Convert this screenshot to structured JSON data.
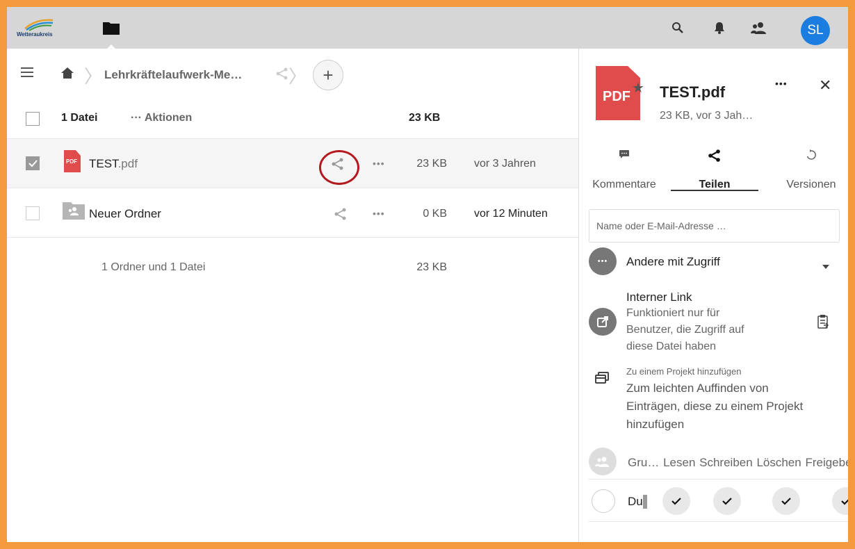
{
  "header": {
    "logo_text": "Wetteraukreis",
    "user_initials": "SL"
  },
  "breadcrumb": {
    "folder": "Lehrkräftelaufwerk-Me…"
  },
  "list_header": {
    "count": "1 Datei",
    "actions": "··· Aktionen",
    "size": "23 KB"
  },
  "files": [
    {
      "name": "TEST",
      "ext": ".pdf",
      "size": "23 KB",
      "date": "vor 3 Jahren",
      "badge": "PDF",
      "selected": true
    },
    {
      "name": "Neuer Ordner",
      "ext": "",
      "size": "0 KB",
      "date": "vor 12 Minuten",
      "selected": false
    }
  ],
  "summary": {
    "text": "1 Ordner und 1 Datei",
    "size": "23 KB"
  },
  "sidebar": {
    "file_title": "TEST.pdf",
    "file_meta": "23 KB, vor 3 Jah…",
    "pdf_badge": "PDF",
    "tabs": [
      {
        "label": "Kommentare"
      },
      {
        "label": "Teilen"
      },
      {
        "label": "Versionen"
      }
    ],
    "share_placeholder": "Name oder E-Mail-Adresse …",
    "others_label": "Andere mit Zugriff",
    "internal_link_title": "Interner Link",
    "internal_link_desc": [
      "Funktioniert nur für",
      "Benutzer, die Zugriff auf",
      "diese Datei haben"
    ],
    "project_small": "Zu einem Projekt hinzufügen",
    "project_hint": [
      "Zum leichten Auffinden von",
      "Einträgen, diese zu einem Projekt",
      "hinzufügen"
    ],
    "perm_header": {
      "group": "Gru…",
      "read": "Lesen",
      "write": "Schreiben",
      "delete": "Löschen",
      "share": "Freigeben"
    },
    "perm_row": {
      "name": "Du"
    }
  },
  "colors": {
    "frame_border": "#f39a3e",
    "topbar": "#d6d6d6",
    "avatar": "#1b7de0",
    "pdf_red": "#e04b4b",
    "highlight": "#b3191e"
  }
}
